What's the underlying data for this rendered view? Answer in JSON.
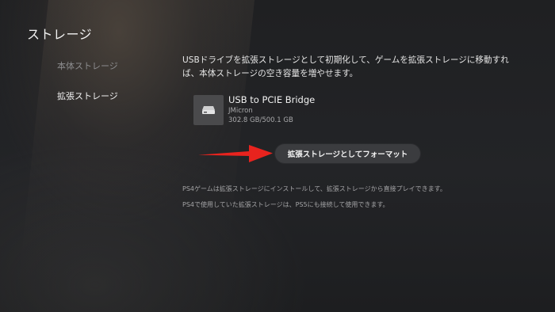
{
  "page": {
    "title": "ストレージ"
  },
  "sidebar": {
    "items": [
      {
        "label": "本体ストレージ",
        "active": false
      },
      {
        "label": "拡張ストレージ",
        "active": true
      }
    ]
  },
  "main": {
    "description": "USBドライブを拡張ストレージとして初期化して、ゲームを拡張ストレージに移動すれば、本体ストレージの空き容量を増やせます。",
    "device": {
      "icon": "hard-drive-icon",
      "name": "USB to PCIE Bridge",
      "maker": "JMicron",
      "capacity": "302.8 GB/500.1 GB"
    },
    "format_button_label": "拡張ストレージとしてフォーマット",
    "notes": [
      "PS4ゲームは拡張ストレージにインストールして、拡張ストレージから直接プレイできます。",
      "PS4で使用していた拡張ストレージは、PS5にも接続して使用できます。"
    ]
  },
  "annotation": {
    "arrow_color": "#e8231e"
  }
}
